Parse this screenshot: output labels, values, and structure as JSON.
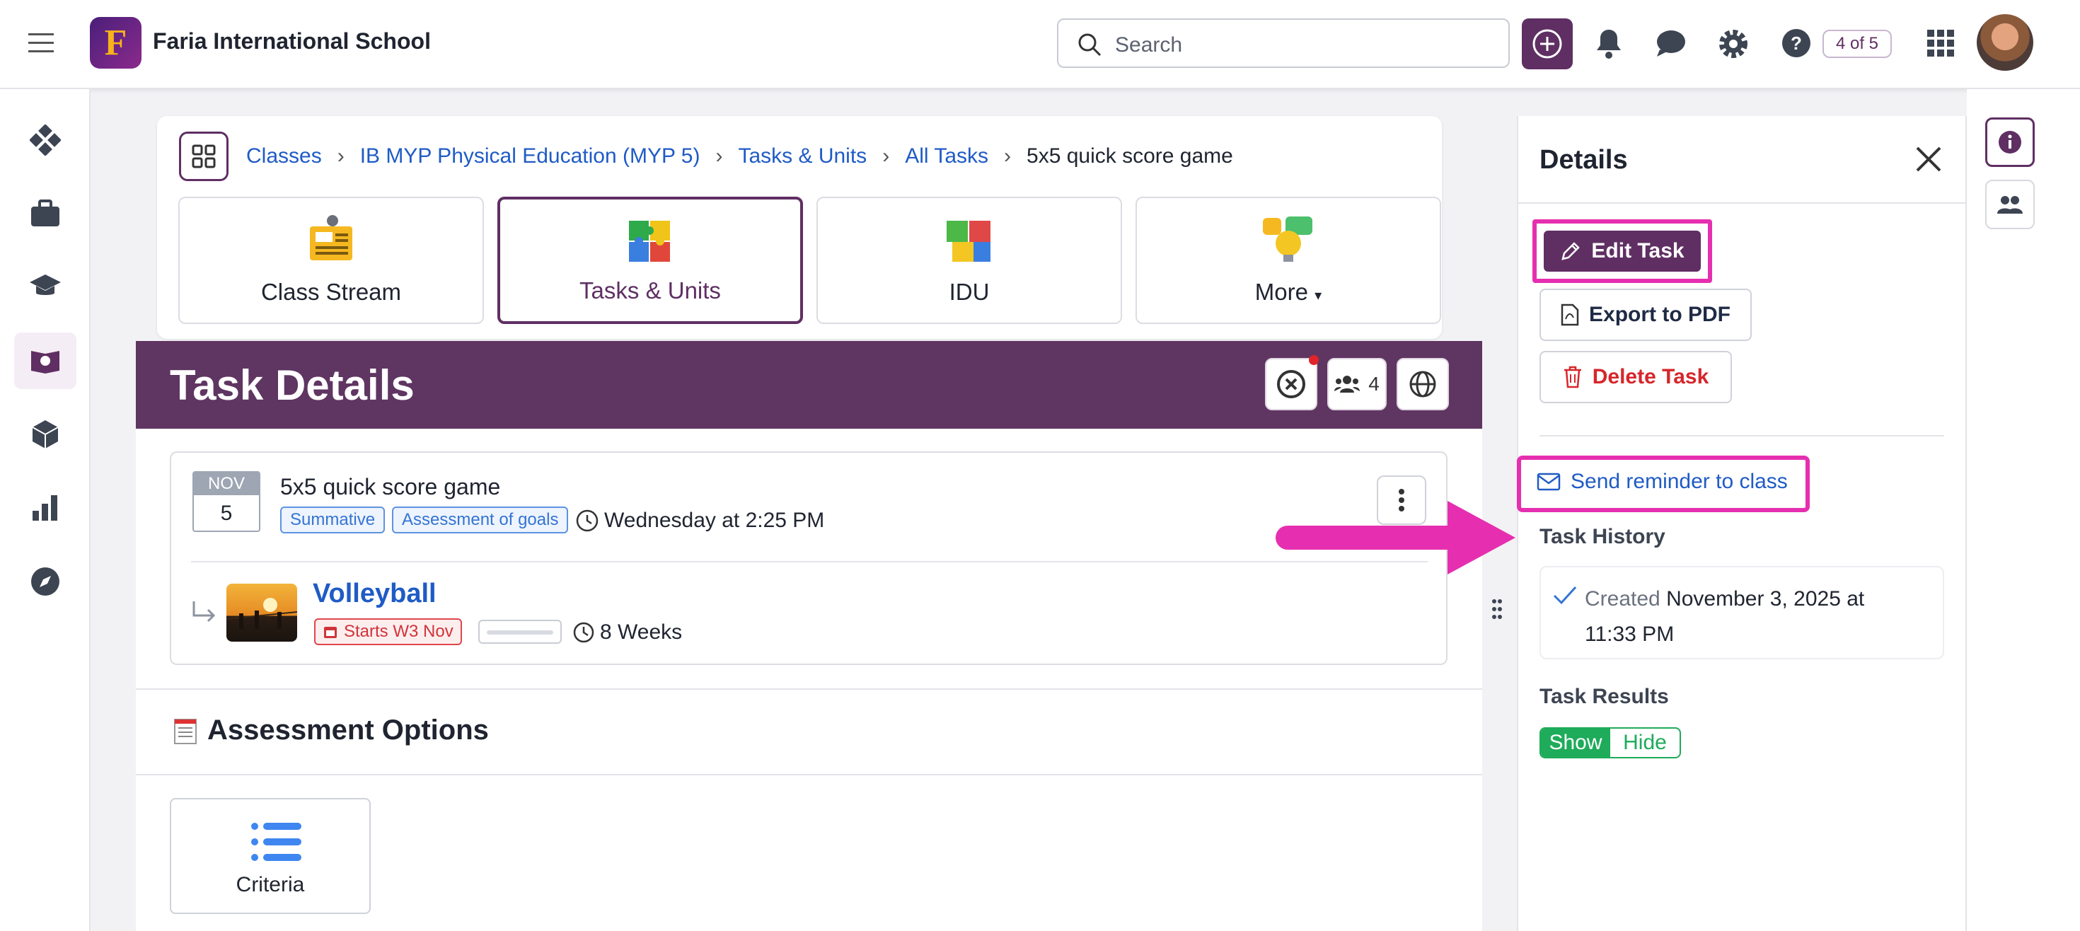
{
  "header": {
    "school_name": "Faria International School",
    "logo_letter": "F",
    "search_placeholder": "Search",
    "help_badge": "4 of 5",
    "accent_color": "#5f2f63"
  },
  "breadcrumb": {
    "items": [
      "Classes",
      "IB MYP Physical Education (MYP 5)",
      "Tasks & Units",
      "All Tasks"
    ],
    "current": "5x5 quick score game"
  },
  "tabs": [
    {
      "label": "Class Stream",
      "icon": "newspaper-icon"
    },
    {
      "label": "Tasks & Units",
      "icon": "puzzle-icon",
      "active": true
    },
    {
      "label": "IDU",
      "icon": "puzzle-pieces-icon"
    },
    {
      "label": "More",
      "icon": "ideas-icon"
    }
  ],
  "task_header": {
    "title": "Task Details",
    "members_count": "4"
  },
  "task": {
    "month": "NOV",
    "day": "5",
    "title": "5x5 quick score game",
    "tags": [
      "Summative",
      "Assessment of goals"
    ],
    "due": "Wednesday at 2:25 PM"
  },
  "unit": {
    "name": "Volleyball",
    "starts": "Starts W3 Nov",
    "duration": "8 Weeks",
    "progress": 0
  },
  "assessment": {
    "title": "Assessment Options",
    "options": [
      {
        "label": "Criteria"
      }
    ]
  },
  "details": {
    "title": "Details",
    "edit_label": "Edit Task",
    "pdf_label": "Export to PDF",
    "delete_label": "Delete Task",
    "reminder_label": "Send reminder to class",
    "history_title": "Task History",
    "history_prefix": "Created",
    "history_date": "November 3, 2025 at 11:33 PM",
    "results_title": "Task Results",
    "show_label": "Show",
    "hide_label": "Hide",
    "highlight_color": "#e62fb0"
  }
}
